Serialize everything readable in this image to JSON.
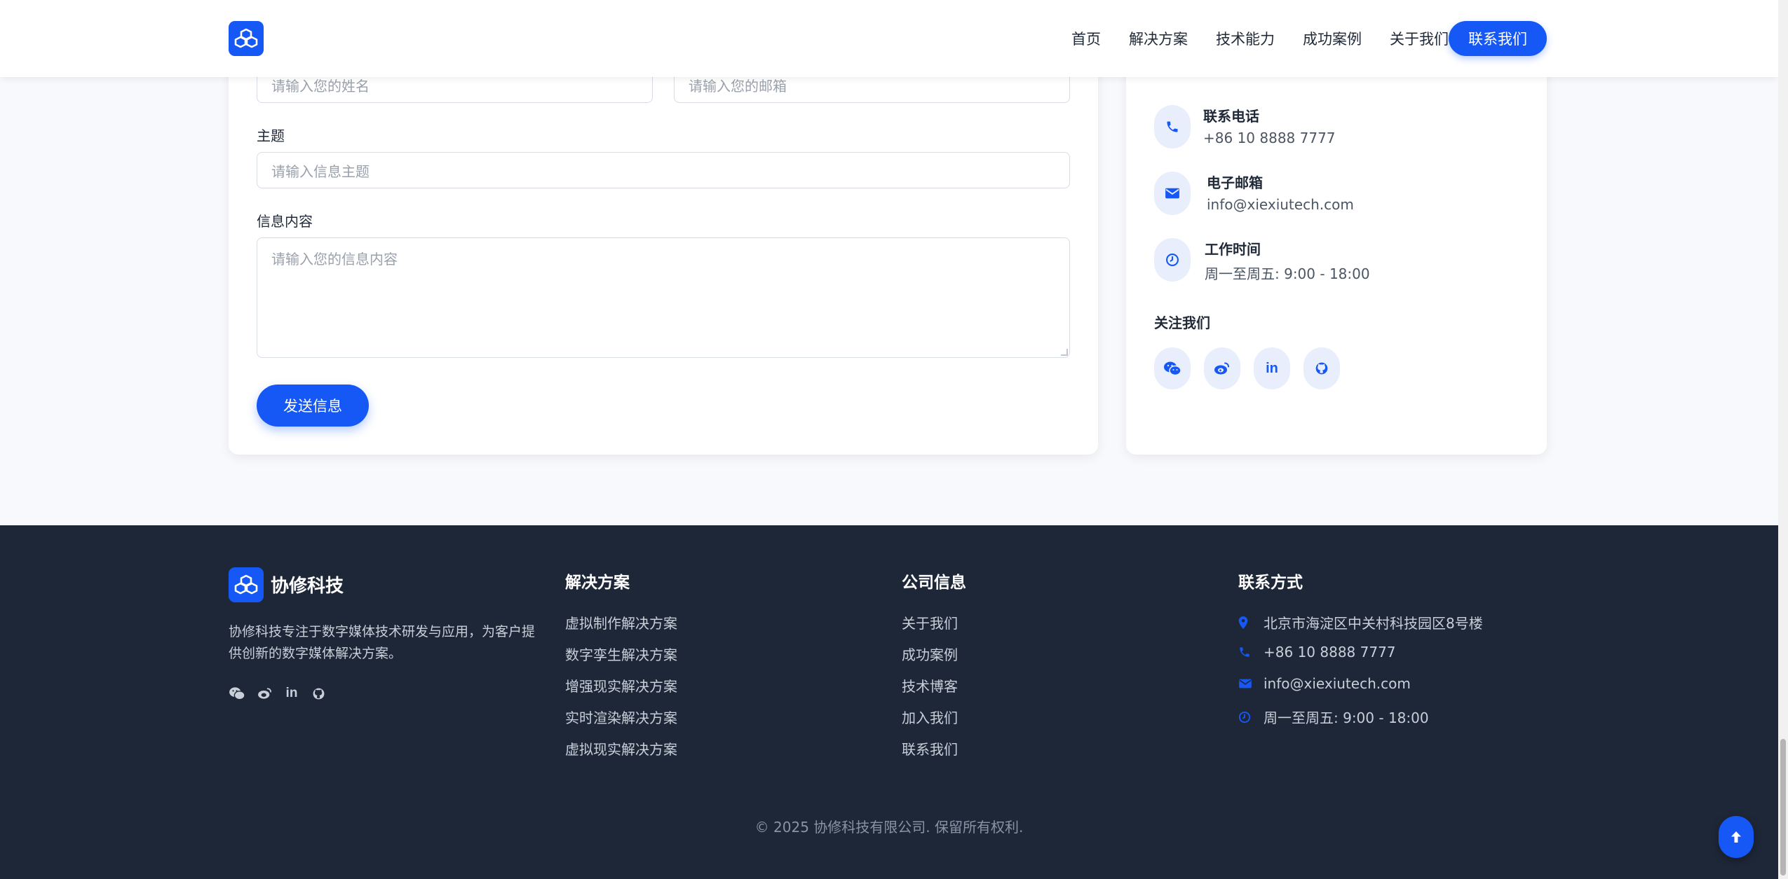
{
  "header": {
    "nav": [
      "首页",
      "解决方案",
      "技术能力",
      "成功案例",
      "关于我们"
    ],
    "cta": "联系我们"
  },
  "form": {
    "name_placeholder": "请输入您的姓名",
    "email_placeholder": "请输入您的邮箱",
    "subject_label": "主题",
    "subject_placeholder": "请输入信息主题",
    "message_label": "信息内容",
    "message_placeholder": "请输入您的信息内容",
    "submit": "发送信息"
  },
  "info": {
    "phone_title": "联系电话",
    "phone_value": "+86 10 8888 7777",
    "email_title": "电子邮箱",
    "email_value": "info@xiexiutech.com",
    "hours_title": "工作时间",
    "hours_value": "周一至周五: 9:00 - 18:00",
    "follow_title": "关注我们",
    "social": [
      "wechat-icon",
      "weibo-icon",
      "linkedin-icon",
      "github-icon"
    ]
  },
  "footer": {
    "brand": "协修科技",
    "description": "协修科技专注于数字媒体技术研发与应用，为客户提供创新的数字媒体解决方案。",
    "solutions_title": "解决方案",
    "solutions": [
      "虚拟制作解决方案",
      "数字孪生解决方案",
      "增强现实解决方案",
      "实时渲染解决方案",
      "虚拟现实解决方案"
    ],
    "company_title": "公司信息",
    "company": [
      "关于我们",
      "成功案例",
      "技术博客",
      "加入我们",
      "联系我们"
    ],
    "contact_title": "联系方式",
    "contact_address": "北京市海淀区中关村科技园区8号楼",
    "contact_phone": "+86 10 8888 7777",
    "contact_email": "info@xiexiutech.com",
    "contact_hours": "周一至周五: 9:00 - 18:00",
    "copyright": "© 2025 协修科技有限公司. 保留所有权利."
  },
  "colors": {
    "accent": "#1558f5",
    "footer_bg": "#1e2738",
    "page_bg": "#f8f9fc"
  }
}
